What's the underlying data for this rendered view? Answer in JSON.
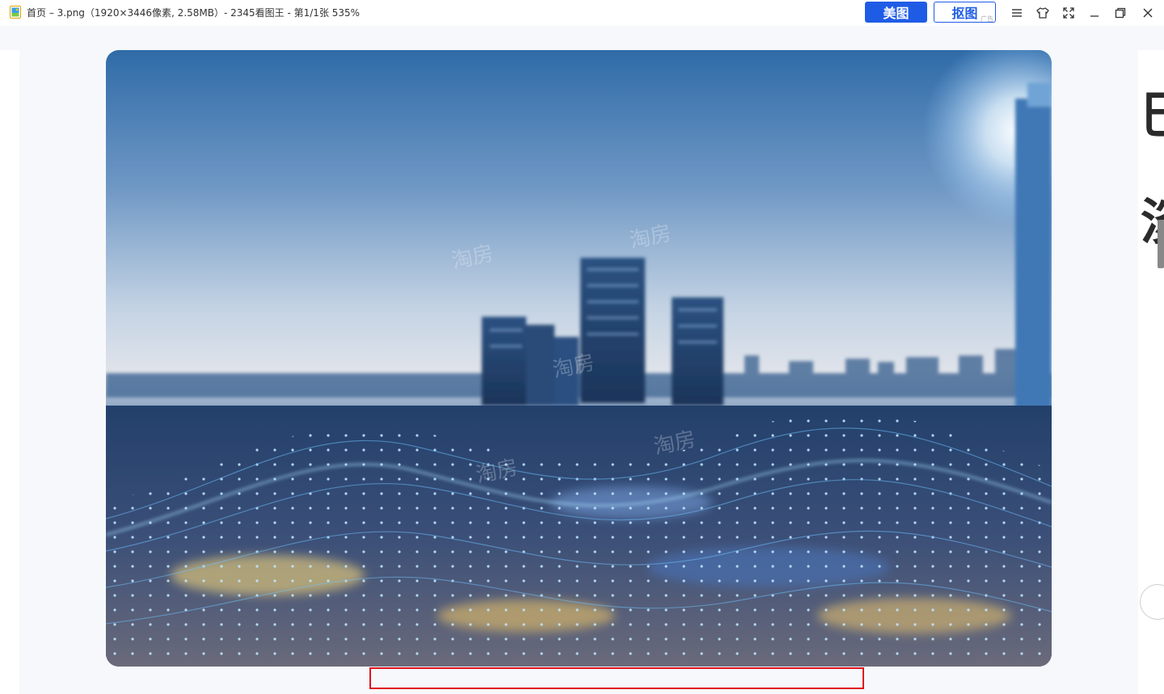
{
  "titlebar": {
    "title": "首页 – 3.png（1920×3446像素, 2.58MB）- 2345看图王 - 第1/1张 535%",
    "buttons": {
      "meitu": "美图",
      "koutu": "抠图",
      "ad_tag": "广告"
    },
    "controls": [
      "menu-icon",
      "skin-icon",
      "fullscreen-icon",
      "minimize-icon",
      "restore-icon",
      "close-icon"
    ]
  },
  "image": {
    "watermark": "淘房"
  },
  "right_page": {
    "glyphs": [
      "巳",
      "淡"
    ]
  },
  "colors": {
    "accent": "#1f5ce6",
    "highlight_box": "#e0141e",
    "viewer_bg": "#f6f8fb"
  }
}
